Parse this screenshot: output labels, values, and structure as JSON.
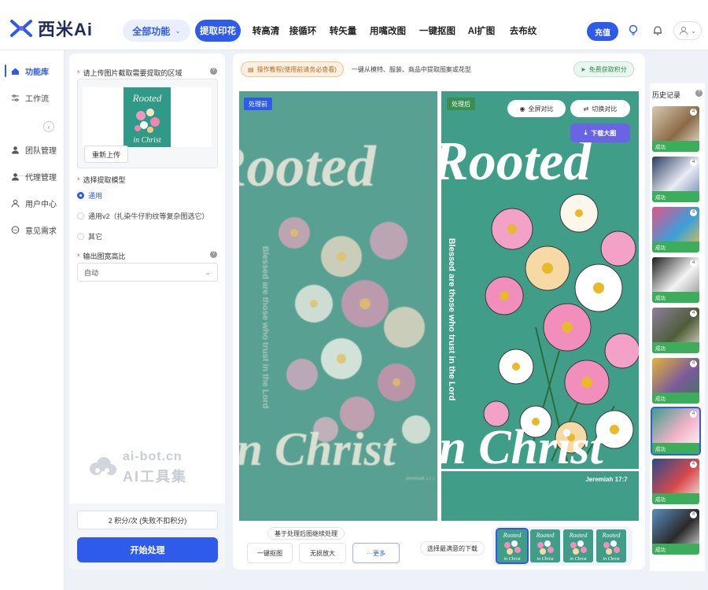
{
  "brand": {
    "name": "西米Ai"
  },
  "header": {
    "all_functions": "全部功能",
    "tabs": [
      {
        "label": "提取印花",
        "active": true
      },
      {
        "label": "转高清"
      },
      {
        "label": "接循环"
      },
      {
        "label": "转矢量"
      },
      {
        "label": "用嘴改图"
      },
      {
        "label": "一键抠图"
      },
      {
        "label": "AI扩图"
      },
      {
        "label": "去布纹"
      }
    ],
    "recharge": "充值",
    "icons": [
      "lightbulb-icon",
      "bell-icon",
      "user-icon"
    ]
  },
  "sidebar": {
    "items": [
      {
        "label": "功能库",
        "icon": "home-icon",
        "active": true
      },
      {
        "label": "工作流",
        "icon": "sliders-icon"
      },
      {
        "label": "团队管理",
        "icon": "user-icon"
      },
      {
        "label": "代理管理",
        "icon": "user-icon"
      },
      {
        "label": "用户中心",
        "icon": "person-outline-icon"
      },
      {
        "label": "意见需求",
        "icon": "chat-icon"
      }
    ]
  },
  "settings": {
    "upload_label": "请上传图片截取需要提取的区域",
    "reupload": "重新上传",
    "model_label": "选择提取模型",
    "models": [
      {
        "label": "通用",
        "selected": true
      },
      {
        "label": "通用v2（扎染牛仔豹纹等复杂图选它）"
      },
      {
        "label": "其它"
      }
    ],
    "ratio_label": "输出图宽高比",
    "ratio_value": "自动",
    "watermark": {
      "line1": "ai-bot.cn",
      "line2": "AI工具集"
    },
    "cost": "2 积分/次 (失败不扣积分)",
    "start": "开始处理"
  },
  "workspace": {
    "tutorial": "操作教程(使用前请务必查看)",
    "hint": "一键从模特、服装、商品中提取图案或花型",
    "free_credits": "免费获取积分",
    "before_tag": "处理前",
    "after_tag": "处理后",
    "fullscreen_compare": "全屏对比",
    "switch_compare": "切换对比",
    "download_large": "下载大图",
    "artwork_text": {
      "top": "Rooted",
      "bottom": "in Christ",
      "side": "Blessed are those who trust in the Lord",
      "tiny": "Jeremiah 17:7"
    },
    "continue_hint": "基于处理后图继续处理",
    "actions": [
      "一键抠图",
      "无损放大",
      "···更多"
    ],
    "pick_hint": "选择最满意的下载",
    "results_count": 4
  },
  "history": {
    "title": "历史记录",
    "status": "成功",
    "items": [
      {
        "count": "4",
        "colors": [
          "#d9c9b1",
          "#8a6a45",
          "#f2ece0"
        ]
      },
      {
        "count": "4",
        "colors": [
          "#2c3a63",
          "#e9ecf4",
          "#6c7fae"
        ]
      },
      {
        "count": "4",
        "colors": [
          "#e5528a",
          "#3aa0d8",
          "#f2c23c"
        ]
      },
      {
        "count": "4",
        "colors": [
          "#1e1e1e",
          "#f4f4f4",
          "#8a8a8a"
        ]
      },
      {
        "count": "4",
        "colors": [
          "#8d7f9c",
          "#4f5d3a",
          "#e8e2d0"
        ]
      },
      {
        "count": "4",
        "colors": [
          "#e5b33a",
          "#7a5a9a",
          "#3a7a5a"
        ]
      },
      {
        "count": "4",
        "colors": [
          "#3f9d88",
          "#f2b3c8",
          "#ffffff"
        ],
        "selected": true
      },
      {
        "count": "4",
        "colors": [
          "#2a4a8a",
          "#d84a4a",
          "#f4f4f4"
        ]
      },
      {
        "count": "4",
        "colors": [
          "#5a8fc0",
          "#2a2a2a",
          "#e8e8e8"
        ]
      }
    ]
  },
  "colors": {
    "accent": "#2f5bea",
    "success": "#3cae5b",
    "teal": "#40a08b",
    "download": "#6a63e6"
  }
}
